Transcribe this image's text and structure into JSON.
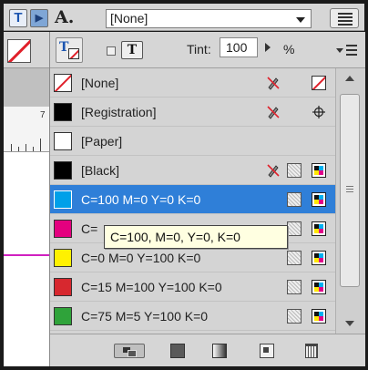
{
  "toolbar": {
    "text_tool_glyph": "T",
    "text_tool_alt_glyph": "▶",
    "font_glyph": "A.",
    "font_value": "[None]"
  },
  "panel": {
    "tint_label": "Tint:",
    "tint_value": "100",
    "tint_unit": "%",
    "format_button_glyph": "T"
  },
  "swatches": [
    {
      "name": "[None]",
      "chip": "none",
      "icons": [
        "pencil-crossed-icon",
        "none-swatch-icon"
      ]
    },
    {
      "name": "[Registration]",
      "chip": "#000000",
      "icons": [
        "pencil-crossed-icon",
        "registration-icon"
      ]
    },
    {
      "name": "[Paper]",
      "chip": "#ffffff",
      "icons": []
    },
    {
      "name": "[Black]",
      "chip": "#000000",
      "icons": [
        "pencil-crossed-icon",
        "process-icon",
        "cmyk-icon"
      ]
    },
    {
      "name": "C=100 M=0 Y=0 K=0",
      "chip": "#00a0e9",
      "selected": true,
      "icons": [
        "process-icon",
        "cmyk-icon"
      ]
    },
    {
      "name": "C=",
      "chip": "#e4007f",
      "icons": [
        "process-icon",
        "cmyk-icon"
      ]
    },
    {
      "name": "C=0 M=0 Y=100 K=0",
      "chip": "#fff100",
      "icons": [
        "process-icon",
        "cmyk-icon"
      ]
    },
    {
      "name": "C=15 M=100 Y=100 K=0",
      "chip": "#d7282f",
      "icons": [
        "process-icon",
        "cmyk-icon"
      ]
    },
    {
      "name": "C=75 M=5 Y=100 K=0",
      "chip": "#2fa33a",
      "icons": [
        "process-icon",
        "cmyk-icon"
      ]
    }
  ],
  "tooltip": {
    "text": "C=100, M=0, Y=0, K=0"
  },
  "colors": {
    "selection": "#2f7fd8",
    "panel_bg": "#d4d4d4",
    "tooltip_bg": "#ffffe1"
  }
}
